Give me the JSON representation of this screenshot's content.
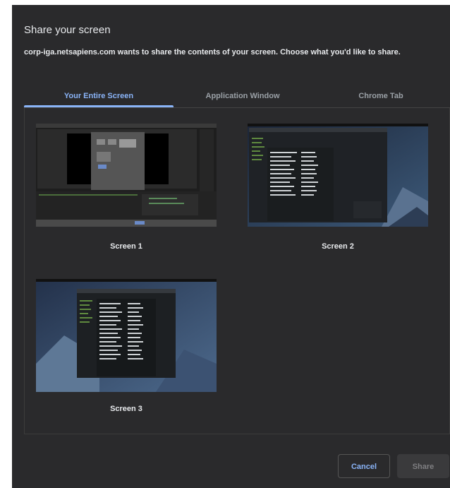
{
  "dialog": {
    "title": "Share your screen",
    "description": "corp-iga.netsapiens.com wants to share the contents of your screen. Choose what you'd like to share."
  },
  "tabs": [
    {
      "label": "Your Entire Screen",
      "active": true
    },
    {
      "label": "Application Window",
      "active": false
    },
    {
      "label": "Chrome Tab",
      "active": false
    }
  ],
  "sources": [
    {
      "label": "Screen 1"
    },
    {
      "label": "Screen 2"
    },
    {
      "label": "Screen 3"
    }
  ],
  "actions": {
    "cancel_label": "Cancel",
    "share_label": "Share"
  },
  "colors": {
    "accent": "#8ab4f8",
    "dialog_bg": "#2a2a2c"
  }
}
